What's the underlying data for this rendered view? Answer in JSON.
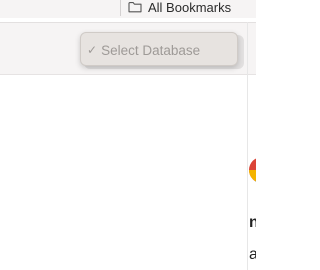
{
  "bookmarks_bar": {
    "all_bookmarks_label": "All Bookmarks",
    "folder_icon": "folder-icon"
  },
  "select_popup": {
    "selected_item_label": "Select Database",
    "check_mark": "✓",
    "check_icon": "checkmark-icon"
  },
  "page_fragments": {
    "logo_icon": "chrome-logo-icon",
    "fragment_1": "n",
    "fragment_2": "a"
  },
  "colors": {
    "popup_background": "#e7e3e0",
    "popup_text": "#9e9a97",
    "toolbar_background": "#f6f4f4"
  }
}
